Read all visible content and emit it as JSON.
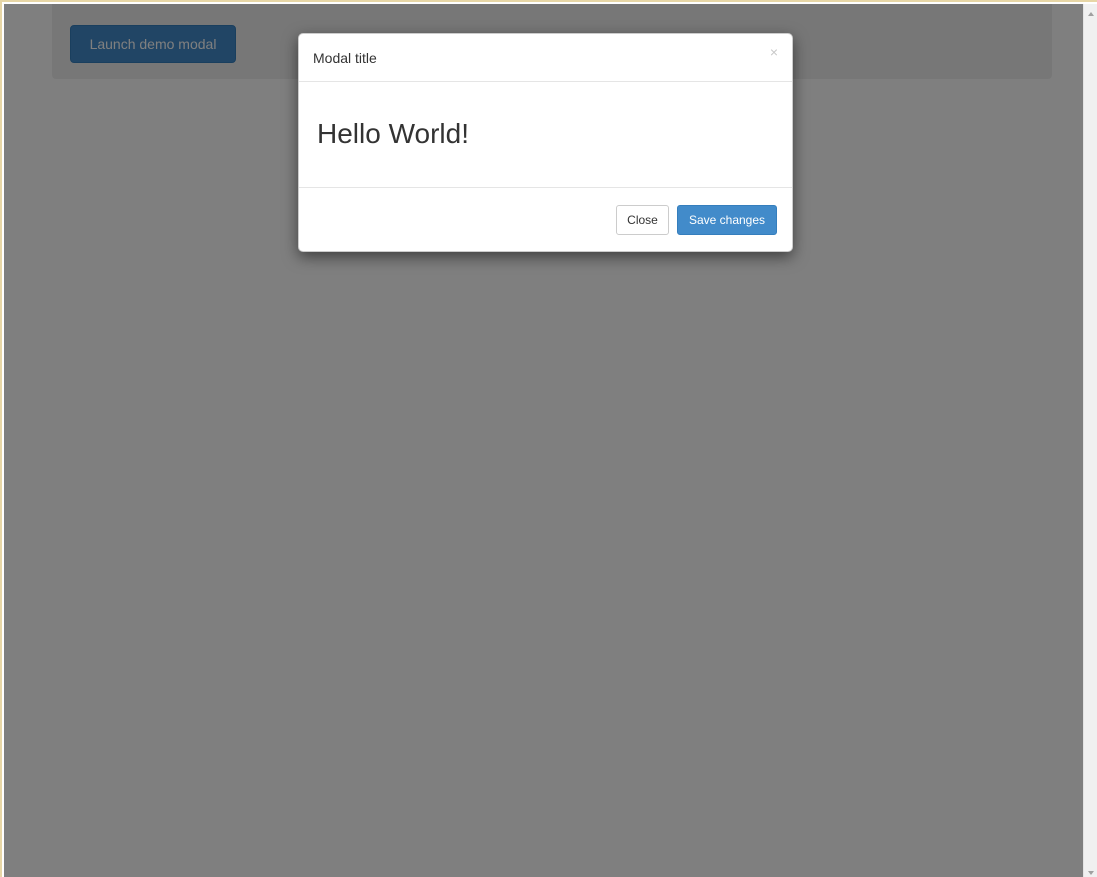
{
  "page": {
    "launch_button_label": "Launch demo modal"
  },
  "modal": {
    "title": "Modal title",
    "close_symbol": "×",
    "body_text": "Hello World!",
    "footer": {
      "close_label": "Close",
      "save_label": "Save changes"
    }
  },
  "icons": {
    "modal_close": "close-icon",
    "scroll_up": "scroll-up-arrow-icon",
    "scroll_down": "scroll-down-arrow-icon"
  },
  "colors": {
    "primary": "#428bca",
    "backdrop": "rgba(0,0,0,0.5)",
    "jumbotron": "#eeeeee"
  }
}
